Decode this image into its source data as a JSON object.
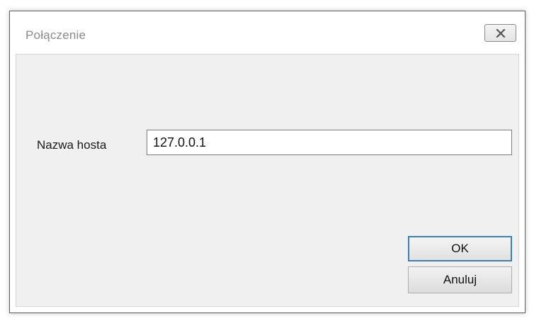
{
  "window": {
    "title": "Połączenie"
  },
  "form": {
    "host_label": "Nazwa hosta",
    "host_value": "127.0.0.1"
  },
  "buttons": {
    "ok_label": "OK",
    "cancel_label": "Anuluj"
  },
  "icons": {
    "close": "close-icon"
  },
  "colors": {
    "client_background": "#f0f0f0",
    "focus_border": "#3c7fb1"
  }
}
